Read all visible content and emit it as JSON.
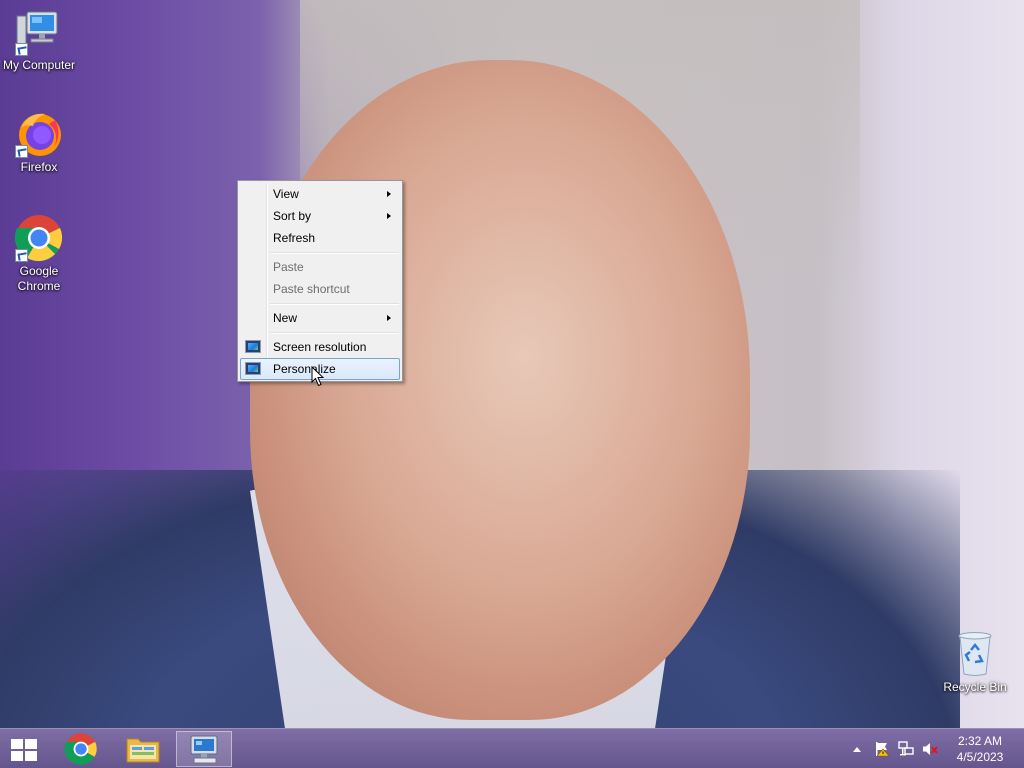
{
  "desktop": {
    "icons": [
      {
        "label": "My Computer",
        "icon": "computer-icon"
      },
      {
        "label": "Firefox",
        "icon": "firefox-icon"
      },
      {
        "label": "Google Chrome",
        "icon": "chrome-icon"
      },
      {
        "label": "Recycle Bin",
        "icon": "recycle-bin-icon"
      }
    ]
  },
  "context_menu": {
    "items": [
      {
        "label": "View",
        "submenu": true,
        "enabled": true
      },
      {
        "label": "Sort by",
        "submenu": true,
        "enabled": true
      },
      {
        "label": "Refresh",
        "submenu": false,
        "enabled": true
      },
      {
        "label": "Paste",
        "submenu": false,
        "enabled": false
      },
      {
        "label": "Paste shortcut",
        "submenu": false,
        "enabled": false
      },
      {
        "label": "New",
        "submenu": true,
        "enabled": true
      },
      {
        "label": "Screen resolution",
        "submenu": false,
        "enabled": true,
        "icon": "display-icon"
      },
      {
        "label": "Personalize",
        "submenu": false,
        "enabled": true,
        "icon": "display-icon",
        "highlighted": true
      }
    ]
  },
  "taskbar": {
    "pinned": [
      {
        "name": "start-button",
        "icon": "windows-logo-icon"
      },
      {
        "name": "chrome-taskbar-button",
        "icon": "chrome-icon"
      },
      {
        "name": "file-explorer-taskbar-button",
        "icon": "folder-icon"
      },
      {
        "name": "control-panel-taskbar-button",
        "icon": "display-settings-icon",
        "active": true
      }
    ],
    "tray_icons": [
      "show-hidden-icons-arrow-icon",
      "action-center-flag-icon",
      "network-icon",
      "volume-muted-icon"
    ],
    "clock": {
      "time": "2:32 AM",
      "date": "4/5/2023"
    }
  },
  "colors": {
    "menu_background": "#f0f0f0",
    "menu_highlight": "#d9e9fb",
    "menu_highlight_border": "#7da2ce",
    "taskbar": "#6a5496",
    "disabled_text": "#6d6d6d"
  }
}
